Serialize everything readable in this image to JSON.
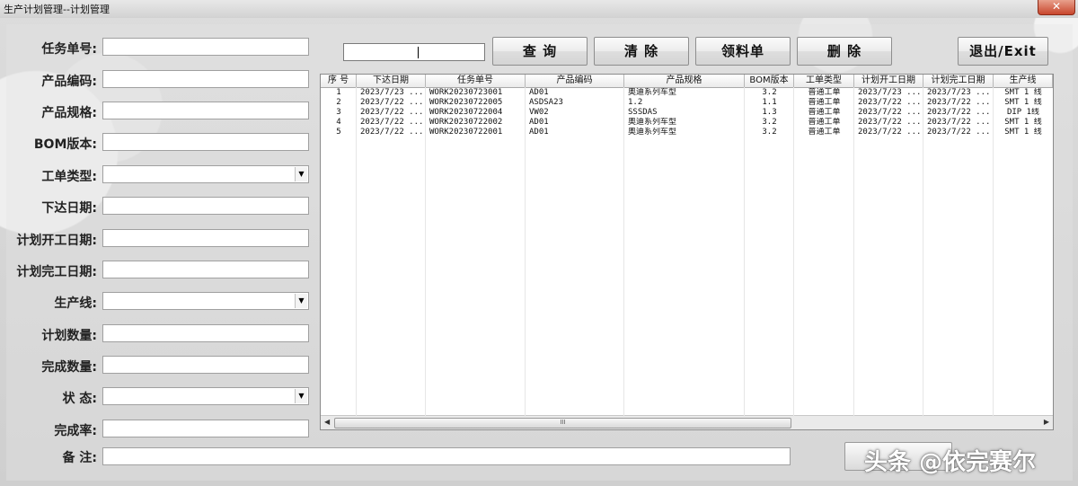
{
  "window": {
    "title": "生产计划管理--计划管理",
    "close_label": "✕"
  },
  "form": {
    "task_no": "任务单号:",
    "product_code": "产品编码:",
    "product_spec": "产品规格:",
    "bom_version": "BOM版本:",
    "order_type": "工单类型:",
    "issue_date": "下达日期:",
    "plan_start": "计划开工日期:",
    "plan_end": "计划完工日期:",
    "line": "生产线:",
    "plan_qty": "计划数量:",
    "done_qty": "完成数量:",
    "status": "状 态:",
    "rate": "完成率:",
    "notes": "备 注:"
  },
  "toolbar": {
    "query": "查 询",
    "clear": "清 除",
    "picking": "领料单",
    "delete": "删 除",
    "exit": "退出/Exit"
  },
  "grid": {
    "columns": [
      "序 号",
      "下达日期",
      "任务单号",
      "产品编码",
      "产品规格",
      "BOM版本",
      "工单类型",
      "计划开工日期",
      "计划完工日期",
      "生产线"
    ],
    "rows": [
      [
        "1",
        "2023/7/23 ...",
        "WORK20230723001",
        "AD01",
        "奥迪系列车型",
        "3.2",
        "普通工单",
        "2023/7/23 ...",
        "2023/7/23 ...",
        "SMT 1 线"
      ],
      [
        "2",
        "2023/7/22 ...",
        "WORK20230722005",
        "ASDSA23",
        "1.2",
        "1.1",
        "普通工单",
        "2023/7/22 ...",
        "2023/7/22 ...",
        "SMT 1 线"
      ],
      [
        "3",
        "2023/7/22 ...",
        "WORK20230722004",
        "VW02",
        "SSSDAS",
        "1.3",
        "普通工单",
        "2023/7/22 ...",
        "2023/7/22 ...",
        "DIP 1线"
      ],
      [
        "4",
        "2023/7/22 ...",
        "WORK20230722002",
        "AD01",
        "奥迪系列车型",
        "3.2",
        "普通工单",
        "2023/7/22 ...",
        "2023/7/22 ...",
        "SMT 1 线"
      ],
      [
        "5",
        "2023/7/22 ...",
        "WORK20230722001",
        "AD01",
        "奥迪系列车型",
        "3.2",
        "普通工单",
        "2023/7/22 ...",
        "2023/7/22 ...",
        "SMT 1 线"
      ]
    ],
    "scroll_marker": "III"
  },
  "watermark": "头条 @依完赛尔"
}
